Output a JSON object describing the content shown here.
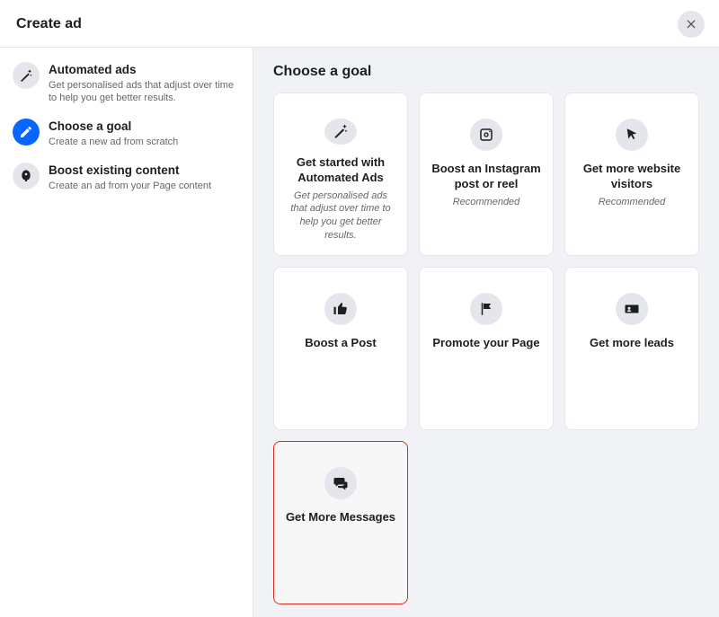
{
  "header": {
    "title": "Create ad"
  },
  "sidebar": {
    "items": [
      {
        "title": "Automated ads",
        "desc": "Get personalised ads that adjust over time to help you get better results."
      },
      {
        "title": "Choose a goal",
        "desc": "Create a new ad from scratch"
      },
      {
        "title": "Boost existing content",
        "desc": "Create an ad from your Page content"
      }
    ]
  },
  "main": {
    "heading": "Choose a goal",
    "cards": [
      {
        "title": "Get started with Automated Ads",
        "desc": "Get personalised ads that adjust over time to help you get better results."
      },
      {
        "title": "Boost an Instagram post or reel",
        "sub": "Recommended"
      },
      {
        "title": "Get more website visitors",
        "sub": "Recommended"
      },
      {
        "title": "Boost a Post"
      },
      {
        "title": "Promote your Page"
      },
      {
        "title": "Get more leads"
      },
      {
        "title": "Get More Messages"
      }
    ]
  }
}
